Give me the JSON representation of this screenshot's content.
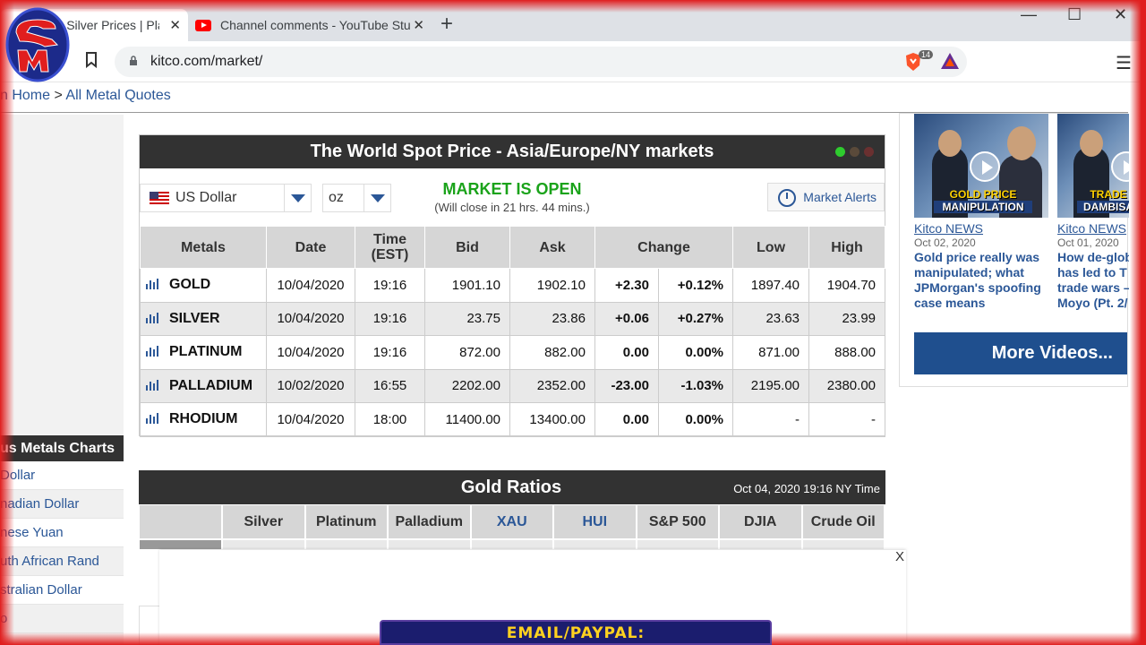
{
  "browser": {
    "tabs": [
      {
        "title": "es | Silver Prices | Pla"
      },
      {
        "title": "Channel comments - YouTube Stu"
      }
    ],
    "new_tab": "+",
    "url": "kitco.com/market/",
    "brave_badge": "14",
    "window_controls": {
      "minimize": "—",
      "maximize": "☐",
      "close": "✕"
    }
  },
  "breadcrumb": {
    "home": "n Home",
    "sep": ">",
    "current": "All Metal Quotes"
  },
  "spot": {
    "title": "The World Spot Price - Asia/Europe/NY markets",
    "currency": "US Dollar",
    "unit": "oz",
    "market_status": "MARKET IS OPEN",
    "market_close": "(Will close in 21 hrs. 44 mins.)",
    "alerts": "Market Alerts",
    "status_colors": [
      "#2ecc2e",
      "#5a4a3a",
      "#6a3030"
    ],
    "headers": {
      "metals": "Metals",
      "date": "Date",
      "time": "Time",
      "time_zone": "(EST)",
      "bid": "Bid",
      "ask": "Ask",
      "change": "Change",
      "low": "Low",
      "high": "High"
    },
    "rows": [
      {
        "metal": "GOLD",
        "date": "10/04/2020",
        "time": "19:16",
        "bid": "1901.10",
        "ask": "1902.10",
        "change": "+2.30",
        "pct": "+0.12%",
        "low": "1897.40",
        "high": "1904.70",
        "trend": "pos"
      },
      {
        "metal": "SILVER",
        "date": "10/04/2020",
        "time": "19:16",
        "bid": "23.75",
        "ask": "23.86",
        "change": "+0.06",
        "pct": "+0.27%",
        "low": "23.63",
        "high": "23.99",
        "trend": "pos"
      },
      {
        "metal": "PLATINUM",
        "date": "10/04/2020",
        "time": "19:16",
        "bid": "872.00",
        "ask": "882.00",
        "change": "0.00",
        "pct": "0.00%",
        "low": "871.00",
        "high": "888.00",
        "trend": "zero"
      },
      {
        "metal": "PALLADIUM",
        "date": "10/02/2020",
        "time": "16:55",
        "bid": "2202.00",
        "ask": "2352.00",
        "change": "-23.00",
        "pct": "-1.03%",
        "low": "2195.00",
        "high": "2380.00",
        "trend": "neg"
      },
      {
        "metal": "RHODIUM",
        "date": "10/04/2020",
        "time": "18:00",
        "bid": "11400.00",
        "ask": "13400.00",
        "change": "0.00",
        "pct": "0.00%",
        "low": "-",
        "high": "-",
        "trend": "zero"
      }
    ]
  },
  "ratios": {
    "title": "Gold Ratios",
    "timestamp": "Oct 04, 2020 19:16 NY Time",
    "columns": [
      "Silver",
      "Platinum",
      "Palladium",
      "XAU",
      "HUI",
      "S&P 500",
      "DJIA",
      "Crude Oil"
    ]
  },
  "pm_charts": {
    "title": "us Metals Charts",
    "items": [
      "Dollar",
      "nadian Dollar",
      "nese Yuan",
      "uth African Rand",
      "stralian Dollar",
      "o"
    ]
  },
  "videos": {
    "items": [
      {
        "source": "Kitco NEWS",
        "date": "Oct 02, 2020",
        "title_lines": [
          "Gold price really was",
          "manipulated; what",
          "JPMorgan's spoofing",
          "case means"
        ],
        "caption_top": "GOLD PRICE",
        "caption_bottom": "MANIPULATION"
      },
      {
        "source": "Kitco NEWS",
        "date": "Oct 01, 2020",
        "title_lines": [
          "How de-glob",
          "has led to T",
          "trade wars –",
          "Moyo (Pt. 2/"
        ],
        "caption_top": "TRADE",
        "caption_bottom": "DAMBISA"
      }
    ],
    "more": "More Videos..."
  },
  "popup": {
    "close": "X"
  },
  "overlay": {
    "email": "EMAIL/PAYPAL: SALIVATEMETAL@GMAIL.COM"
  }
}
